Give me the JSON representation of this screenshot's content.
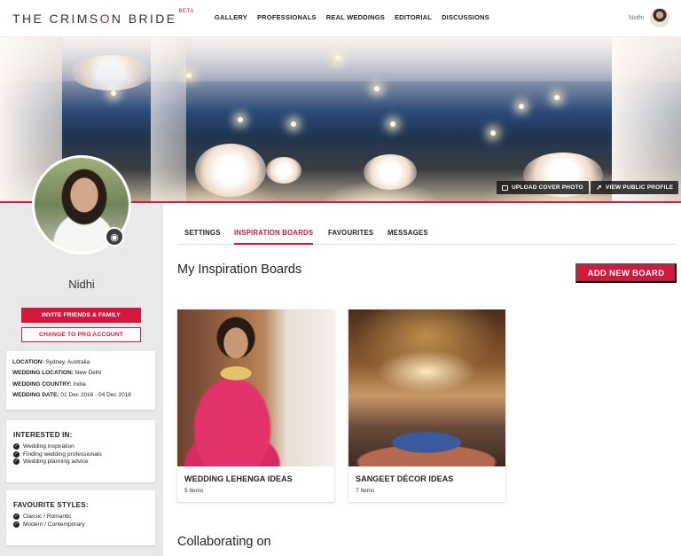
{
  "header": {
    "logo_part1": "THE CRIMS",
    "logo_accent": "O",
    "logo_part2": "N BRIDE",
    "logo_badge": "BETA",
    "nav": [
      "GALLERY",
      "PROFESSIONALS",
      "REAL WEDDINGS",
      "EDITORIAL",
      "DISCUSSIONS"
    ],
    "user_name": "Nidhi"
  },
  "cover": {
    "upload_label": "UPLOAD COVER PHOTO",
    "view_profile_label": "VIEW PUBLIC PROFILE"
  },
  "sidebar": {
    "name": "Nidhi",
    "invite_label": "INVITE FRIENDS & FAMILY",
    "pro_label": "CHANGE TO PRO ACCOUNT",
    "details": [
      {
        "label": "LOCATION:",
        "value": "Sydney, Australia"
      },
      {
        "label": "WEDDING LOCATION:",
        "value": "New Delhi"
      },
      {
        "label": "WEDDING COUNTRY:",
        "value": "India"
      },
      {
        "label": "WEDDING DATE:",
        "value": "01 Dec 2016 - 04 Dec 2016"
      }
    ],
    "interests": {
      "title": "INTERESTED IN:",
      "items": [
        "Wedding inspiration",
        "Finding wedding professionals",
        "Wedding planning advice"
      ]
    },
    "styles": {
      "title": "FAVOURITE STYLES:",
      "items": [
        "Classic / Romantic",
        "Modern / Contemporary"
      ]
    }
  },
  "tabs": [
    "SETTINGS",
    "INSPIRATION BOARDS",
    "FAVOURITES",
    "MESSAGES"
  ],
  "active_tab": "INSPIRATION BOARDS",
  "main": {
    "section_title": "My Inspiration Boards",
    "add_board_label": "ADD NEW BOARD",
    "boards": [
      {
        "title": "WEDDING LEHENGA IDEAS",
        "count": "5 Items"
      },
      {
        "title": "SANGEET DÉCOR IDEAS",
        "count": "7 Items"
      }
    ],
    "collab_title": "Collaborating on"
  },
  "colors": {
    "accent": "#d4183d",
    "sidebar_bg": "#e9e9e9"
  },
  "icons": [
    "image-icon",
    "external-link-icon",
    "camera-icon",
    "check-circle-icon"
  ]
}
